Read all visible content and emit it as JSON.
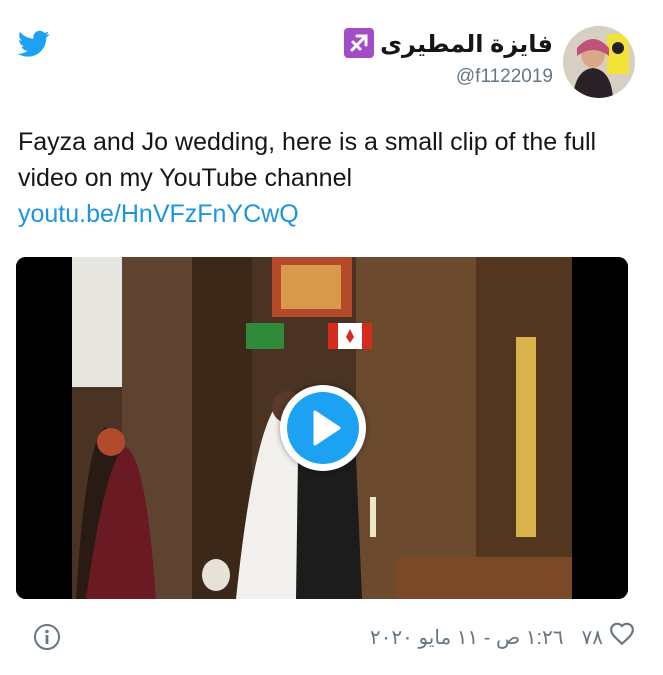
{
  "author": {
    "display_name": "فايزة المطيرى",
    "zodiac_icon": "sagittarius-icon",
    "handle": "@f1122019"
  },
  "tweet": {
    "text": "Fayza and Jo wedding, here is a small clip of the full video on my YouTube channel",
    "link": "youtu.be/HnVFzFnYCwQ"
  },
  "media": {
    "type": "video",
    "play_icon": "play-icon"
  },
  "footer": {
    "timestamp": "١:٢٦ ص - ١١ مايو ٢٠٢٠",
    "likes_count": "٧٨",
    "info_icon": "info-icon",
    "like_icon": "heart-icon"
  },
  "colors": {
    "twitter_blue": "#1da1f2",
    "link_blue": "#1b95e0",
    "secondary_text": "#657786",
    "zodiac_purple": "#a24dc7"
  }
}
